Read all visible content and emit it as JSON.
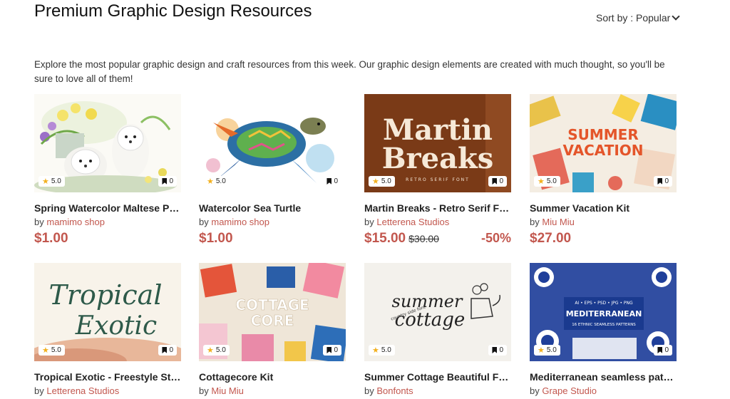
{
  "header": {
    "title": "Premium Graphic Design Resources",
    "sort_label": "Sort by : Popular"
  },
  "description": "Explore the most popular graphic design and craft resources from this week. Our graphic design elements are created with much thought, so you'll be sure to love all of them!",
  "products": [
    {
      "title": "Spring Watercolor Maltese Pup...",
      "by": "by",
      "shop": "mamimo shop",
      "price": "$1.00",
      "old_price": "",
      "discount": "",
      "rating": "5.0",
      "saves": "0"
    },
    {
      "title": "Watercolor Sea Turtle",
      "by": "by",
      "shop": "mamimo shop",
      "price": "$1.00",
      "old_price": "",
      "discount": "",
      "rating": "5.0",
      "saves": "0"
    },
    {
      "title": "Martin Breaks - Retro Serif Font",
      "by": "by",
      "shop": "Letterena Studios",
      "price": "$15.00",
      "old_price": "$30.00",
      "discount": "-50%",
      "rating": "5.0",
      "saves": "0",
      "thumb_text": [
        "Martin",
        "Breaks",
        "RETRO SERIF FONT"
      ]
    },
    {
      "title": "Summer Vacation Kit",
      "by": "by",
      "shop": "Miu Miu",
      "price": "$27.00",
      "old_price": "",
      "discount": "",
      "rating": "5.0",
      "saves": "0",
      "thumb_text": [
        "SUMMER",
        "VACATION"
      ]
    },
    {
      "title": "Tropical Exotic - Freestyle Styli...",
      "by": "by",
      "shop": "Letterena Studios",
      "price": "",
      "old_price": "",
      "discount": "",
      "rating": "5.0",
      "saves": "0",
      "thumb_text": [
        "Tropical",
        "Exotic"
      ]
    },
    {
      "title": "Cottagecore Kit",
      "by": "by",
      "shop": "Miu Miu",
      "price": "",
      "old_price": "",
      "discount": "",
      "rating": "5.0",
      "saves": "0",
      "thumb_text": [
        "COTTAGE",
        "CORE"
      ]
    },
    {
      "title": "Summer Cottage Beautiful Far...",
      "by": "by",
      "shop": "Bonfonts",
      "price": "",
      "old_price": "",
      "discount": "",
      "rating": "5.0",
      "saves": "0",
      "thumb_text": [
        "summer",
        "cottage",
        "country side font"
      ]
    },
    {
      "title": "Mediterranean seamless patter...",
      "by": "by",
      "shop": "Grape Studio",
      "price": "",
      "old_price": "",
      "discount": "",
      "rating": "5.0",
      "saves": "0",
      "thumb_text": [
        "AI • EPS • PSD • JPG • PNG",
        "MEDITERRANEAN",
        "16 ETHNIC SEAMLESS PATTERNS"
      ]
    }
  ],
  "colors": {
    "accent": "#c2574e",
    "star": "#f2b01e"
  }
}
